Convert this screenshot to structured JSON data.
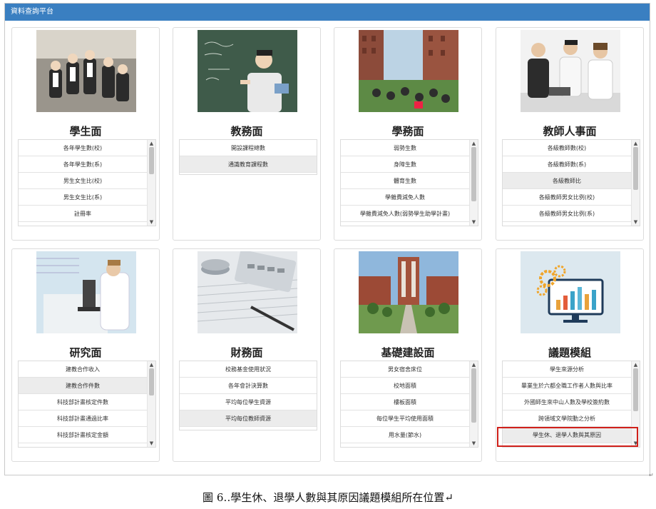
{
  "window": {
    "title": "資料查詢平台"
  },
  "cards": [
    {
      "title": "學生面",
      "photo": "students-group-photo",
      "items": [
        {
          "label": "各年學生數(校)",
          "shaded": false
        },
        {
          "label": "各年學生數(系)",
          "shaded": false
        },
        {
          "label": "男生女生比(校)",
          "shaded": false
        },
        {
          "label": "男生女生比(系)",
          "shaded": false
        },
        {
          "label": "註冊率",
          "shaded": false
        }
      ],
      "scroll": true
    },
    {
      "title": "教務面",
      "photo": "teacher-blackboard-photo",
      "items": [
        {
          "label": "開設課程總數",
          "shaded": false
        },
        {
          "label": "通識教育課程數",
          "shaded": true
        }
      ],
      "scroll": false
    },
    {
      "title": "學務面",
      "photo": "campus-students-photo",
      "items": [
        {
          "label": "弱勢生數",
          "shaded": false
        },
        {
          "label": "身障生數",
          "shaded": false
        },
        {
          "label": "體育生數",
          "shaded": false
        },
        {
          "label": "學雜費減免人數",
          "shaded": false
        },
        {
          "label": "學雜費減免人數(弱勢學生助學計畫)",
          "shaded": false
        }
      ],
      "scroll": true
    },
    {
      "title": "教師人事面",
      "photo": "office-meeting-photo",
      "items": [
        {
          "label": "各級教師數(校)",
          "shaded": false
        },
        {
          "label": "各級教師數(系)",
          "shaded": false
        },
        {
          "label": "各級教師比",
          "shaded": true
        },
        {
          "label": "各級教師男女比例(校)",
          "shaded": false
        },
        {
          "label": "各級教師男女比例(系)",
          "shaded": false
        }
      ],
      "scroll": true
    },
    {
      "title": "研究面",
      "photo": "lab-researcher-photo",
      "items": [
        {
          "label": "建教合作收入",
          "shaded": false
        },
        {
          "label": "建教合作件數",
          "shaded": true
        },
        {
          "label": "科技部計畫核定件數",
          "shaded": false
        },
        {
          "label": "科技部計畫通過比率",
          "shaded": false
        },
        {
          "label": "科技部計畫核定金額",
          "shaded": false
        }
      ],
      "scroll": true
    },
    {
      "title": "財務面",
      "photo": "finance-calculator-photo",
      "items": [
        {
          "label": "校務基金使用狀況",
          "shaded": false
        },
        {
          "label": "各年會計決算數",
          "shaded": false
        },
        {
          "label": "平均每位學生資源",
          "shaded": false
        },
        {
          "label": "平均每位教師資源",
          "shaded": true
        }
      ],
      "scroll": false
    },
    {
      "title": "基礎建設面",
      "photo": "campus-building-photo",
      "items": [
        {
          "label": "男女宿舍床位",
          "shaded": false
        },
        {
          "label": "校地面積",
          "shaded": false
        },
        {
          "label": "樓板面積",
          "shaded": false
        },
        {
          "label": "每位學生平均使用面積",
          "shaded": false
        },
        {
          "label": "用水量(節水)",
          "shaded": false
        }
      ],
      "scroll": true
    },
    {
      "title": "議題模組",
      "photo": "analytics-monitor-icon",
      "items": [
        {
          "label": "學生來源分析",
          "shaded": false
        },
        {
          "label": "畢業生於六都全職工作者人數與比率",
          "shaded": false
        },
        {
          "label": "外國師生來中山人數及學校簽約數",
          "shaded": false
        },
        {
          "label": "跨領域文學院動之分析",
          "shaded": false
        },
        {
          "label": "學生休、退學人數與其原因",
          "shaded": true
        }
      ],
      "scroll": true
    }
  ],
  "caption": "圖 6‥學生休、退學人數與其原因議題模組所在位置↵",
  "colors": {
    "titlebar": "#3a7fc1",
    "highlight": "#d0201a"
  }
}
